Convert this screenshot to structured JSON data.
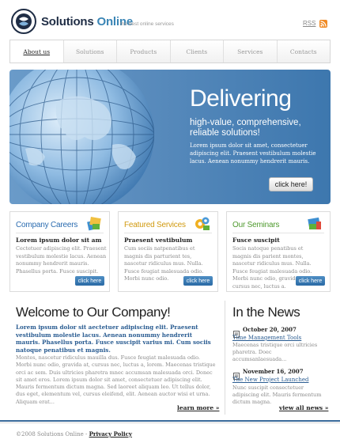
{
  "header": {
    "logo_bold": "Solutions",
    "logo_accent": "Online",
    "tagline": "the best online services",
    "rss_label": "RSS"
  },
  "nav": {
    "items": [
      {
        "label": "About us"
      },
      {
        "label": "Solutions"
      },
      {
        "label": "Products"
      },
      {
        "label": "Clients"
      },
      {
        "label": "Services"
      },
      {
        "label": "Contacts"
      }
    ]
  },
  "banner": {
    "title": "Delivering",
    "subtitle": "high-value, comprehensive, reliable solutions!",
    "body": "Lorem ipsum dolor sit amet, consectetuer adipiscing elit. Praesent vestibulum molestie lacus. Aenean nonummy hendrerit mauris.",
    "button": "click here!"
  },
  "columns": [
    {
      "title": "Company Careers",
      "title_color": "#2b6cb0",
      "heading": "Lorem ipsum dolor sit am",
      "body": "Cectetuer adipiscing elit. Praesent vestibulum molestie lacus. Aenean nonummy hendrerit mauris. Phasellus porta. Fusce suscipit.",
      "button": "click here"
    },
    {
      "title": "Featured Services",
      "title_color": "#d19a10",
      "heading": "Praesent vestibulum",
      "body": "Cum sociis natpenatibus et magnis dis parturient tes, nascetur ridiculus mus. Nulla. Fusce feugiat malesuada odio. Morbi nunc odio.",
      "button": "click here"
    },
    {
      "title": "Our Seminars",
      "title_color": "#4f9a2e",
      "heading": "Fusce suscipit",
      "body": "Socis natoque penatibus et magnis dis parient montes, nascetur ridiculus mus. Nulla. Fusce feugiat malesuada odio. Morbi nunc odio, gravida at, cursus nec, luctus a.",
      "button": "click here"
    }
  ],
  "welcome": {
    "title": "Welcome to Our Company!",
    "lead": "Lorem ipsum dolor sit aectetuer adipiscing elit. Praesent vestibulum molestie lacus. Aenean nonummy hendrerit mauris. Phasellus porta. Fusce suscipit varius mi. Cum sociis natoque penatibus et magnis.",
    "body": "Montes, nascetur ridiculus mauilla dus. Fusce feugiat malesuada odio. Morbi nunc odio, gravida at, cursus nec, luctus a, lorem. Maecenas tristique orci ac sem. Duis ultricies pharetra mnec accumsan malesuada orci. Donec sit amet eros. Lorem ipsum dolor sit amet, consectetuer adipiscing elit. Mauris fermentum dictum magna. Sed laoreet aliquam leo. Ut tellus dolor, dus eget, elementum vel, cursus eleifend, elit. Aenean auctor wisi et urna. Aliquam erat...",
    "learn_more": "learn more »"
  },
  "news": {
    "title": "In the News",
    "items": [
      {
        "date": "October 20, 2007",
        "link": "Time Management Tools",
        "text": "Maecenas tristique orci ultricies pharetra. Doec accumsanlaesuada..."
      },
      {
        "date": "November 16, 2007",
        "link": "The New Project Launched",
        "text": "Nunc suscipit consectetuer adipiscing elit. Mauris fermentum dictum magna."
      }
    ],
    "view_all": "view all news »"
  },
  "footer": {
    "copyright": "©2008 Solutions Online - ",
    "policy": "Privacy Policy"
  }
}
